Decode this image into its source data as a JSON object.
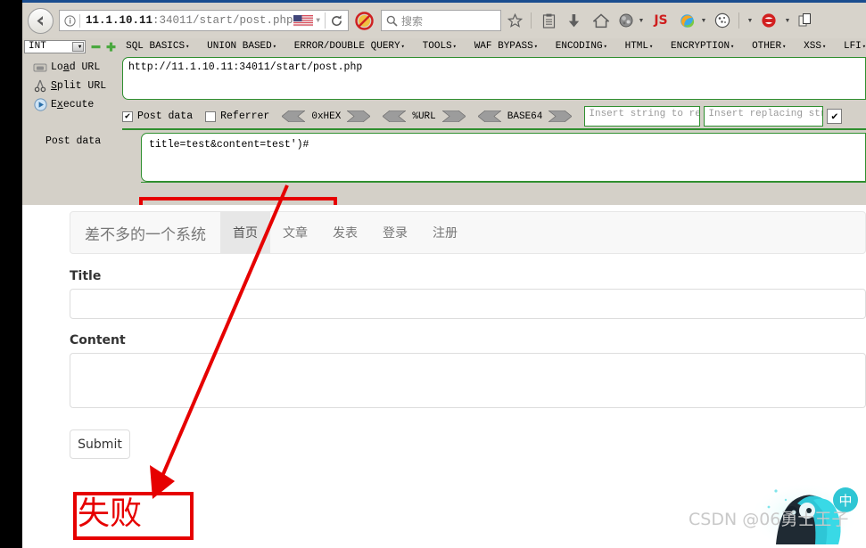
{
  "browser": {
    "url_host": "11.1.10.11",
    "url_rest": ":34011/start/post.php",
    "flag_icon": "us-flag-icon",
    "reload_icon": "reload-icon",
    "info_icon": "info-icon",
    "back_icon": "back-arrow-icon",
    "noscript_icon": "noscript-icon",
    "search_placeholder": "搜索",
    "search_icon": "search-icon",
    "toolbar_icons": [
      {
        "name": "bookmark-star-icon",
        "glyph": "☆"
      },
      {
        "name": "reading-list-icon",
        "glyph": "📋"
      },
      {
        "name": "downloads-icon",
        "glyph": "⬇"
      },
      {
        "name": "home-icon",
        "glyph": "⌂"
      },
      {
        "name": "hackbar-globe-icon",
        "glyph": "●"
      },
      {
        "name": "javascript-toggle-icon",
        "label": "JS"
      },
      {
        "name": "firefox-swirl-icon",
        "glyph": "●"
      },
      {
        "name": "cookie-manager-icon",
        "glyph": "●"
      },
      {
        "name": "stylish-icon",
        "glyph": "●"
      },
      {
        "name": "page-copy-icon",
        "glyph": "❐"
      }
    ]
  },
  "hackbar": {
    "type_select": "INT",
    "minus_icon": "minus-icon",
    "plus_icon": "plus-icon",
    "menus": [
      "SQL BASICS",
      "UNION BASED",
      "ERROR/DOUBLE QUERY",
      "TOOLS",
      "WAF BYPASS",
      "ENCODING",
      "HTML",
      "ENCRYPTION",
      "OTHER",
      "XSS",
      "LFI"
    ],
    "actions": [
      {
        "label_pre": "Lo",
        "label_key": "a",
        "label_post": "d URL",
        "icon": "load-url-icon"
      },
      {
        "label_pre": "",
        "label_key": "S",
        "label_post": "plit URL",
        "icon": "split-url-icon"
      },
      {
        "label_pre": "E",
        "label_key": "x",
        "label_post": "ecute",
        "icon": "execute-icon"
      }
    ],
    "url_value": "http://11.1.10.11:34011/start/post.php",
    "post_data_checkbox": {
      "label": "Post data",
      "checked": true
    },
    "referrer_checkbox": {
      "label": "Referrer",
      "checked": false
    },
    "converters": [
      "0xHEX",
      "%URL",
      "BASE64"
    ],
    "insert_search_placeholder": "Insert string to replace",
    "insert_replace_placeholder": "Insert replacing string",
    "last_checkbox_checked": true,
    "post_data_label": "Post data",
    "post_data_value": "title=test&content=test')#"
  },
  "page": {
    "brand": "差不多的一个系统",
    "nav": [
      {
        "label": "首页",
        "active": true
      },
      {
        "label": "文章",
        "active": false
      },
      {
        "label": "发表",
        "active": false
      },
      {
        "label": "登录",
        "active": false
      },
      {
        "label": "注册",
        "active": false
      }
    ],
    "title_label": "Title",
    "title_value": "",
    "content_label": "Content",
    "content_value": "",
    "submit_label": "Submit",
    "result_text": "失败"
  },
  "annotation": {
    "highlight_color": "#e60000",
    "arrow_name": "red-annotation-arrow"
  },
  "watermark": {
    "text": "CSDN @06勇士王子"
  }
}
